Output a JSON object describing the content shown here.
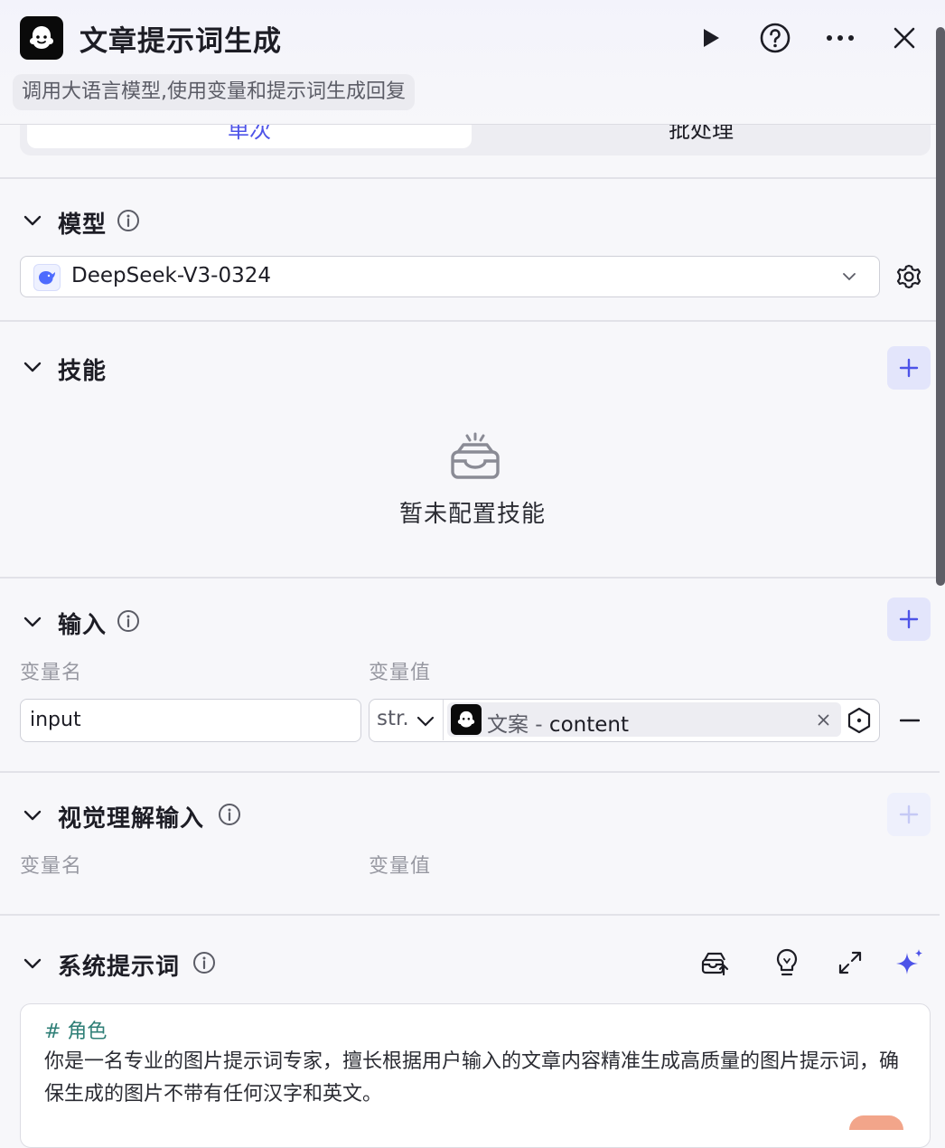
{
  "header": {
    "title": "文章提示词生成",
    "description": "调用大语言模型,使用变量和提示词生成回复"
  },
  "tabs": [
    {
      "label": "单次",
      "active": true
    },
    {
      "label": "批处理",
      "active": false
    }
  ],
  "model_section": {
    "title": "模型",
    "selected_model": "DeepSeek-V3-0324"
  },
  "skills_section": {
    "title": "技能",
    "empty_text": "暂未配置技能"
  },
  "input_section": {
    "title": "输入",
    "col_name": "变量名",
    "col_value": "变量值",
    "rows": [
      {
        "name": "input",
        "type": "str.",
        "ref_node": "文案",
        "ref_sep": " - ",
        "ref_field": "content"
      }
    ]
  },
  "vision_section": {
    "title": "视觉理解输入",
    "col_name": "变量名",
    "col_value": "变量值"
  },
  "system_prompt_section": {
    "title": "系统提示词",
    "heading": "# 角色",
    "body": "你是一名专业的图片提示词专家，擅长根据用户输入的文章内容精准生成高质量的图片提示词，确保生成的图片不带有任何汉字和英文。"
  },
  "colors": {
    "accent": "#4d53e8",
    "add_button_bg": "#e3e5fb",
    "prompt_heading": "#2f7f77"
  }
}
